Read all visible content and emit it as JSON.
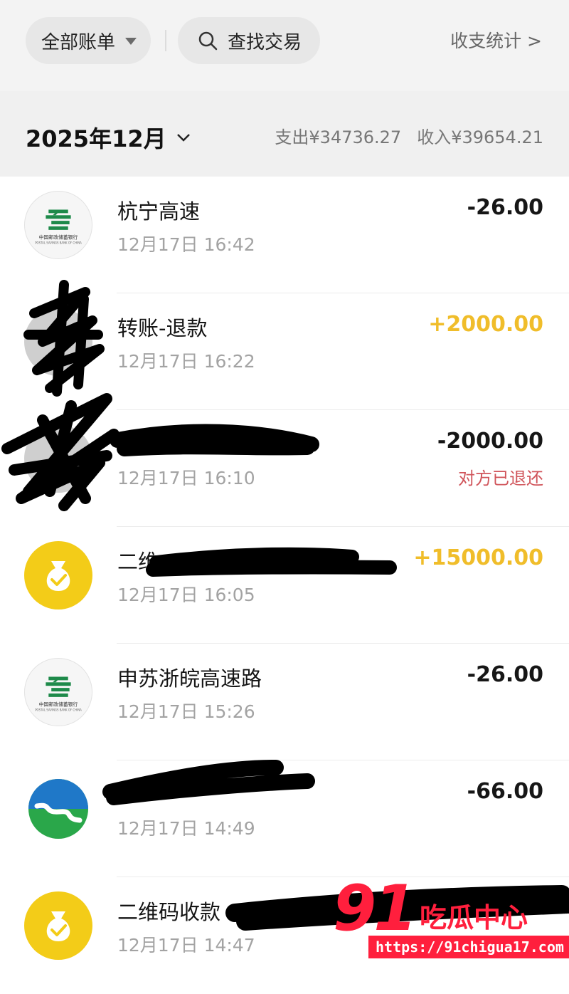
{
  "header": {
    "filter_label": "全部账单",
    "search_label": "查找交易",
    "stats_label": "收支统计 >"
  },
  "month_bar": {
    "month": "2025年12月",
    "expense": "支出¥34736.27",
    "income": "收入¥39654.21"
  },
  "transactions": [
    {
      "merchant": "杭宁高速",
      "time": "12月17日 16:42",
      "amount": "-26.00",
      "type": "expense",
      "icon": "postal-bank-logo"
    },
    {
      "merchant": "转账-退款",
      "time": "12月17日 16:22",
      "amount": "+2000.00",
      "type": "income",
      "icon": "redacted-avatar"
    },
    {
      "merchant": "",
      "time": "12月17日 16:10",
      "amount": "-2000.00",
      "type": "expense",
      "note": "对方已退还",
      "icon": "redacted-avatar"
    },
    {
      "merchant": "二维",
      "time": "12月17日 16:05",
      "amount": "+15000.00",
      "type": "income",
      "icon": "money-bag-icon"
    },
    {
      "merchant": "申苏浙皖高速路",
      "time": "12月17日 15:26",
      "amount": "-26.00",
      "type": "expense",
      "icon": "postal-bank-logo"
    },
    {
      "merchant": "",
      "time": "12月17日 14:49",
      "amount": "-66.00",
      "type": "expense",
      "icon": "road-logo"
    },
    {
      "merchant": "二维码收款",
      "time": "12月17日 14:47",
      "amount": "",
      "type": "income",
      "icon": "money-bag-icon"
    }
  ],
  "bank_logo": {
    "cn": "中国邮政储蓄银行",
    "en": "POSTAL SAVINGS BANK OF CHINA"
  },
  "watermark": {
    "number": "91",
    "text": "吃瓜中心",
    "url": "https://91chigua17.com"
  },
  "colors": {
    "income": "#f0bd2a",
    "expense": "#161616",
    "note": "#d0545a",
    "brand_yellow": "#f3cc18"
  }
}
